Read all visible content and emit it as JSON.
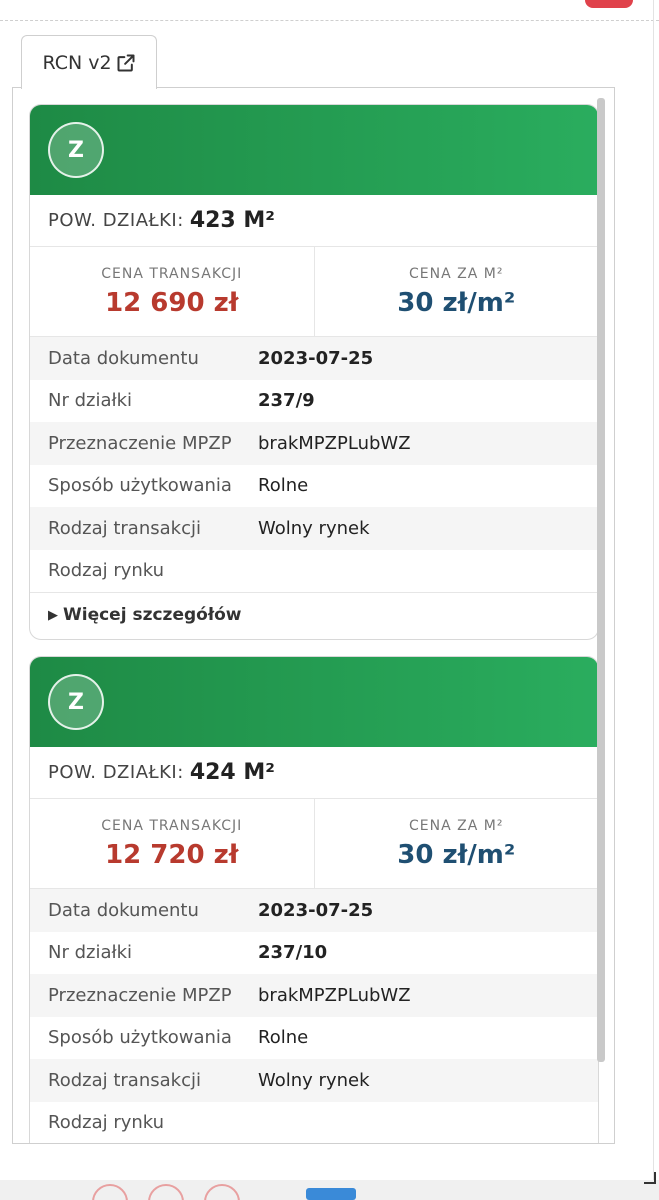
{
  "tab": {
    "label": "RCN v2",
    "icon": "external-link-icon"
  },
  "colors": {
    "header_green": "#2aad5e",
    "price_red": "#b83a2e",
    "price_blue": "#1f4f72"
  },
  "cards": [
    {
      "avatar": "Z",
      "area_label": "POW. DZIAŁKI:",
      "area_value": "423 M²",
      "price_label": "CENA TRANSAKCJI",
      "price_value": "12 690 zł",
      "unit_label": "CENA ZA M²",
      "unit_value": "30 zł/m²",
      "details": [
        {
          "label": "Data dokumentu",
          "value": "2023-07-25"
        },
        {
          "label": "Nr działki",
          "value": "237/9"
        },
        {
          "label": "Przeznaczenie MPZP",
          "value": "brakMPZPLubWZ"
        },
        {
          "label": "Sposób użytkowania",
          "value": "Rolne"
        },
        {
          "label": "Rodzaj transakcji",
          "value": "Wolny rynek"
        },
        {
          "label": "Rodzaj rynku",
          "value": ""
        }
      ],
      "more": "Więcej szczegółów"
    },
    {
      "avatar": "Z",
      "area_label": "POW. DZIAŁKI:",
      "area_value": "424 M²",
      "price_label": "CENA TRANSAKCJI",
      "price_value": "12 720 zł",
      "unit_label": "CENA ZA M²",
      "unit_value": "30 zł/m²",
      "details": [
        {
          "label": "Data dokumentu",
          "value": "2023-07-25"
        },
        {
          "label": "Nr działki",
          "value": "237/10"
        },
        {
          "label": "Przeznaczenie MPZP",
          "value": "brakMPZPLubWZ"
        },
        {
          "label": "Sposób użytkowania",
          "value": "Rolne"
        },
        {
          "label": "Rodzaj transakcji",
          "value": "Wolny rynek"
        },
        {
          "label": "Rodzaj rynku",
          "value": ""
        }
      ]
    }
  ]
}
